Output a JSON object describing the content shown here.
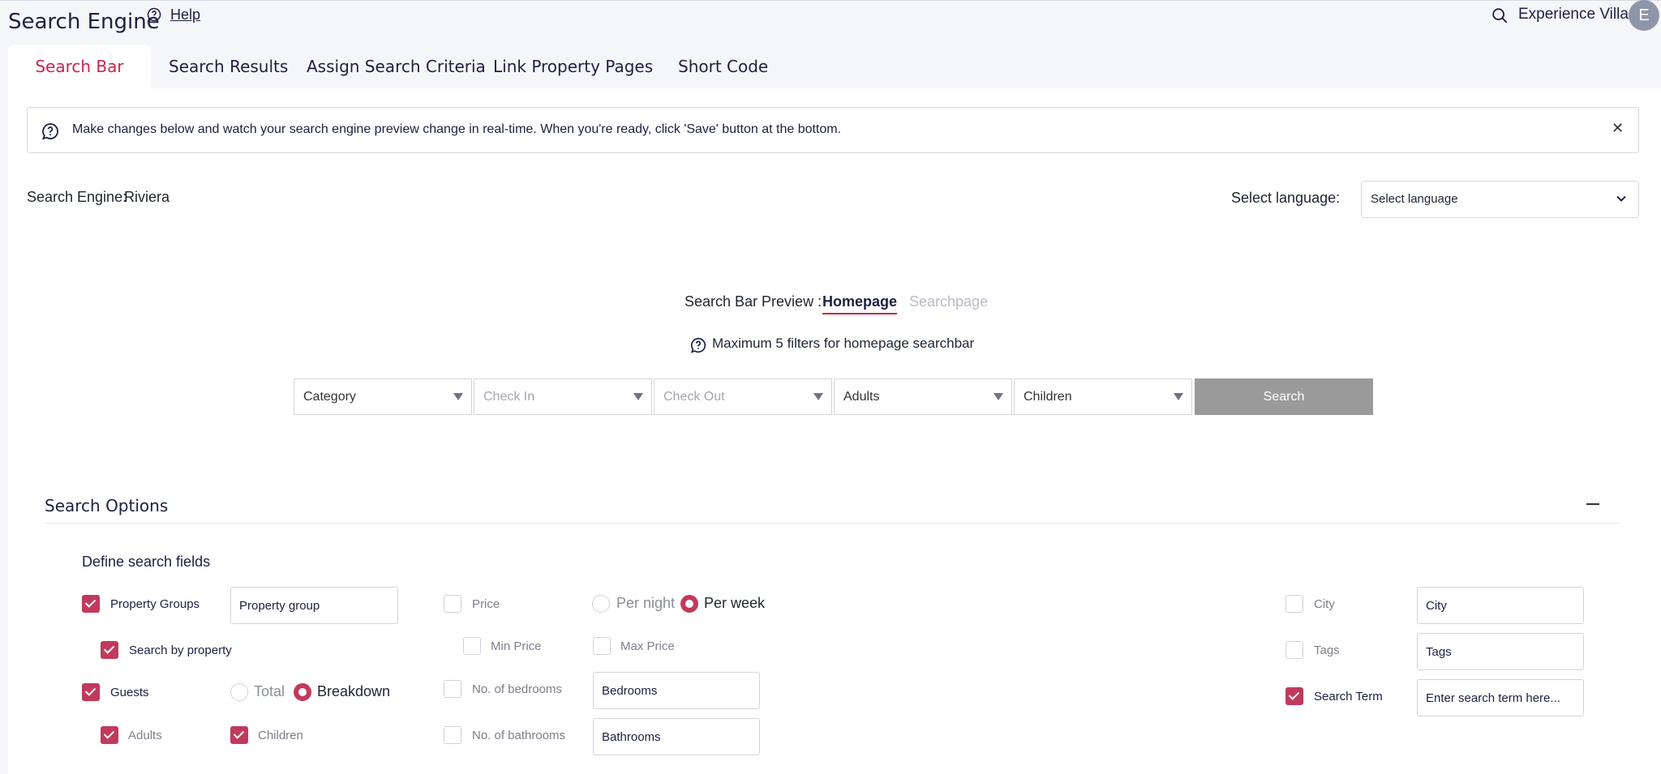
{
  "header": {
    "title": "Search Engine",
    "help_label": "Help",
    "user_name": "Experience Villas",
    "avatar_initial": "E"
  },
  "tabs": [
    {
      "label": "Search Bar",
      "active": true
    },
    {
      "label": "Search Results",
      "active": false
    },
    {
      "label": "Assign Search Criteria",
      "active": false
    },
    {
      "label": "Link Property Pages",
      "active": false
    },
    {
      "label": "Short Code",
      "active": false
    }
  ],
  "info": {
    "message": "Make changes below and watch your search engine preview change in real-time. When you're ready, click 'Save' button at the bottom.",
    "close_glyph": "✕"
  },
  "engine": {
    "label": "Search Engine:",
    "name": "Riviera"
  },
  "language": {
    "label": "Select language:",
    "value": "Select language"
  },
  "preview": {
    "label": "Search Bar Preview :",
    "homepage": "Homepage",
    "searchpage": "Searchpage",
    "max_note": "Maximum 5 filters for homepage searchbar",
    "fields": [
      "Category",
      "Check In",
      "Check Out",
      "Adults",
      "Children"
    ],
    "search_button": "Search"
  },
  "options": {
    "title": "Search Options",
    "define_label": "Define search fields",
    "property_groups": {
      "label": "Property Groups",
      "checked": true,
      "input": "Property group"
    },
    "search_by_property": {
      "label": "Search by property",
      "checked": true
    },
    "guests": {
      "label": "Guests",
      "checked": true,
      "total": "Total",
      "breakdown": "Breakdown"
    },
    "adults": {
      "label": "Adults",
      "checked": true
    },
    "children": {
      "label": "Children",
      "checked": true
    },
    "price": {
      "label": "Price",
      "checked": false,
      "per_night": "Per night",
      "per_week": "Per week"
    },
    "min_price": {
      "label": "Min Price",
      "checked": false
    },
    "max_price": {
      "label": "Max Price",
      "checked": false
    },
    "bedrooms": {
      "label": "No. of bedrooms",
      "checked": false,
      "input": "Bedrooms"
    },
    "bathrooms": {
      "label": "No. of bathrooms",
      "checked": false,
      "input": "Bathrooms"
    },
    "city": {
      "label": "City",
      "checked": false,
      "input": "City"
    },
    "tags": {
      "label": "Tags",
      "checked": false,
      "input": "Tags"
    },
    "search_term": {
      "label": "Search Term",
      "checked": true,
      "input": "Enter search term here..."
    }
  },
  "colors": {
    "accent": "#c13a5c",
    "brand_text": "#1b2140",
    "search_button": "#9a9a9a"
  }
}
